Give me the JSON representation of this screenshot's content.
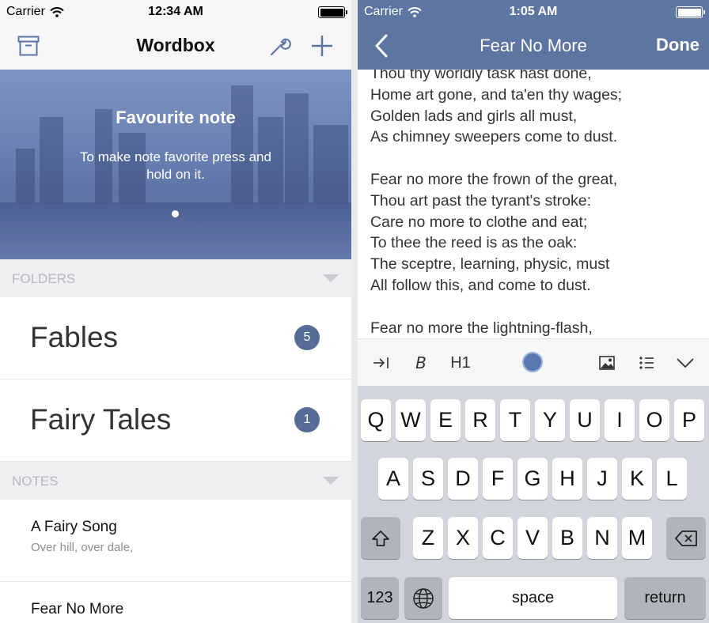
{
  "left": {
    "status": {
      "carrier": "Carrier",
      "time": "12:34 AM"
    },
    "nav": {
      "title": "Wordbox",
      "icons": [
        "archive-icon",
        "wrench-icon",
        "plus-icon"
      ]
    },
    "banner": {
      "heading": "Favourite note",
      "text": "To make note favorite press and hold on it.",
      "page_count": 1,
      "active_page": 1
    },
    "folders_header": "FOLDERS",
    "folders": [
      {
        "name": "Fables",
        "count": "5"
      },
      {
        "name": "Fairy Tales",
        "count": "1"
      }
    ],
    "notes_header": "NOTES",
    "notes": [
      {
        "title": "A Fairy Song",
        "snippet": "Over hill, over dale,"
      },
      {
        "title": "Fear No More",
        "snippet": ""
      }
    ],
    "colors": {
      "badge": "#566b95",
      "header_bg": "#efeff1"
    }
  },
  "right": {
    "status": {
      "carrier": "Carrier",
      "time": "1:05 AM"
    },
    "nav": {
      "title": "Fear No More",
      "done": "Done",
      "back_icon": "chevron-left-icon"
    },
    "lines": [
      "Thou thy worldly task hast done,",
      "Home art gone, and ta'en thy wages;",
      "Golden lads and girls all must,",
      "As chimney sweepers come to dust.",
      "",
      "Fear no more the frown of the great,",
      "Thou art past the tyrant's stroke:",
      "Care no more to clothe and eat;",
      "To thee the reed is as the oak:",
      "The sceptre, learning, physic, must",
      "All follow this, and come to dust.",
      "",
      "Fear no more the lightning-flash,"
    ],
    "format_bar": {
      "indent_icon": "indent-icon",
      "bold": "B",
      "heading": "H1",
      "color": "#5a79b0",
      "image_icon": "image-icon",
      "list_icon": "list-icon",
      "hide_icon": "chevron-down-icon"
    },
    "keyboard": {
      "row1": [
        "Q",
        "W",
        "E",
        "R",
        "T",
        "Y",
        "U",
        "I",
        "O",
        "P"
      ],
      "row2": [
        "A",
        "S",
        "D",
        "F",
        "G",
        "H",
        "J",
        "K",
        "L"
      ],
      "row3": [
        "Z",
        "X",
        "C",
        "V",
        "B",
        "N",
        "M"
      ],
      "numbers": "123",
      "space": "space",
      "return": "return",
      "icons": [
        "shift-icon",
        "backspace-icon",
        "globe-icon"
      ]
    },
    "colors": {
      "accent": "#5d75a1"
    }
  }
}
